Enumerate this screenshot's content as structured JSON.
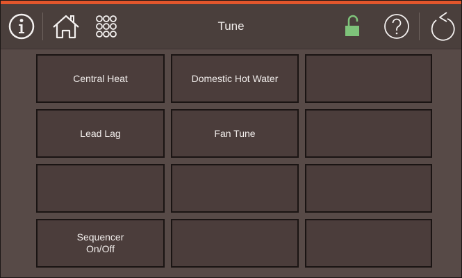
{
  "header": {
    "title": "Tune",
    "icons": {
      "info": "info-icon",
      "home": "home-icon",
      "menu": "keypad-grid-icon",
      "lock": "unlocked-padlock-icon",
      "help": "question-icon",
      "back": "back-arrow-icon"
    },
    "lock_color": "#7ec37a"
  },
  "colors": {
    "accent": "#e2562c",
    "background": "#574a47",
    "header": "#4a3f3c",
    "tile": "#4b3d3b"
  },
  "tiles": [
    {
      "label": "Central Heat"
    },
    {
      "label": "Domestic Hot Water"
    },
    {
      "label": ""
    },
    {
      "label": "Lead Lag"
    },
    {
      "label": "Fan Tune"
    },
    {
      "label": ""
    },
    {
      "label": ""
    },
    {
      "label": ""
    },
    {
      "label": ""
    },
    {
      "label": "Sequencer\nOn/Off"
    },
    {
      "label": ""
    },
    {
      "label": ""
    }
  ]
}
